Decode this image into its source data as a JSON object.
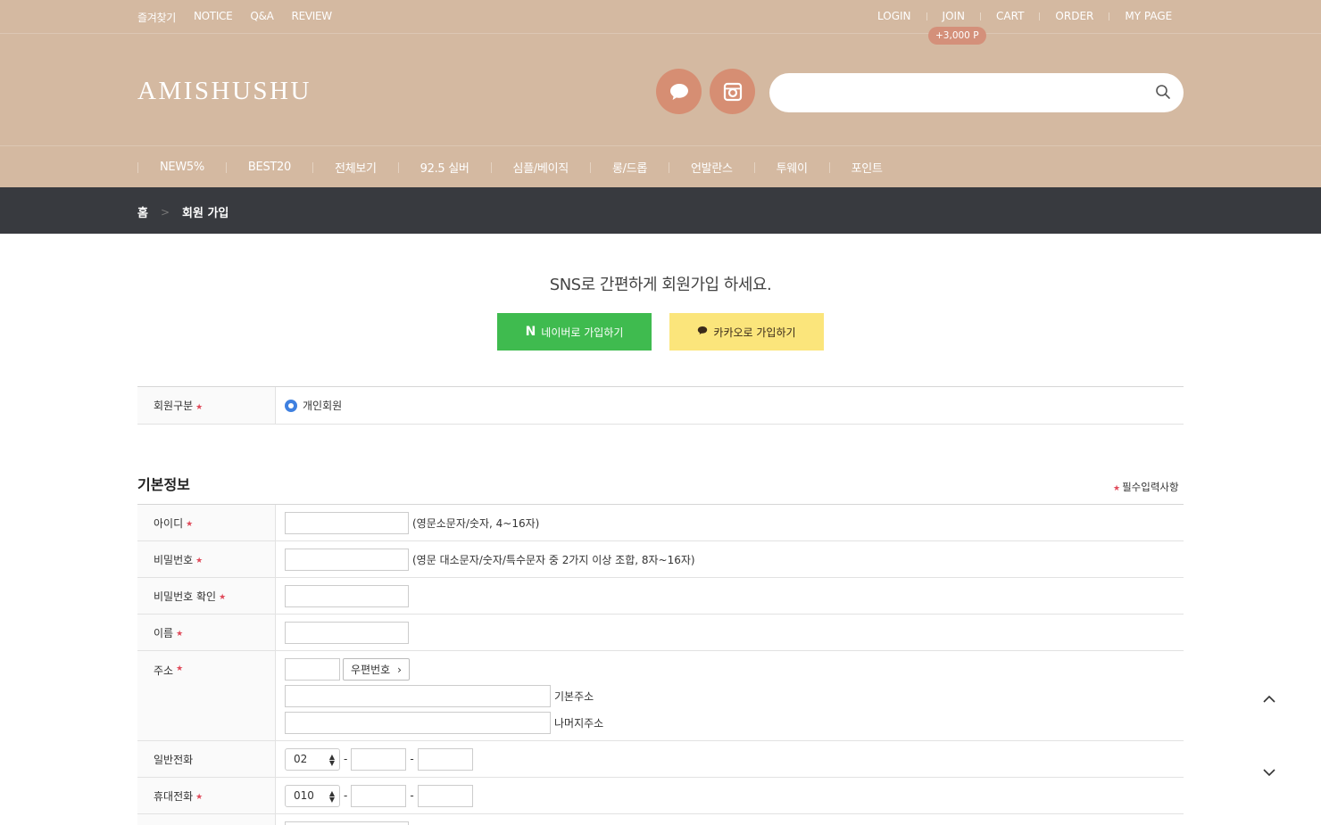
{
  "top_links_left": [
    "즐겨찾기",
    "NOTICE",
    "Q&A",
    "REVIEW"
  ],
  "top_links_right": [
    "LOGIN",
    "JOIN",
    "CART",
    "ORDER",
    "MY PAGE"
  ],
  "points_badge": "+3,000 P",
  "logo": "AMISHUSHU",
  "search": {
    "placeholder": ""
  },
  "icons": {
    "chat": "chat-bubble-icon",
    "instagram": "instagram-icon",
    "search": "search-icon"
  },
  "gnb": [
    "NEW5%",
    "BEST20",
    "전체보기",
    "92.5 실버",
    "심플/베이직",
    "롱/드롭",
    "언발란스",
    "투웨이",
    "포인트"
  ],
  "breadcrumb": {
    "home": "홈",
    "current": "회원 가입"
  },
  "sns": {
    "title": "SNS로 간편하게 회원가입 하세요.",
    "naver": "네이버로 가입하기",
    "kakao": "카카오로 가입하기"
  },
  "member_type": {
    "label": "회원구분",
    "option": "개인회원"
  },
  "basic_info": {
    "title": "기본정보",
    "required_note": "필수입력사항"
  },
  "fields": {
    "id": {
      "label": "아이디",
      "hint": "(영문소문자/숫자, 4~16자)"
    },
    "password": {
      "label": "비밀번호",
      "hint": "(영문 대소문자/숫자/특수문자 중 2가지 이상 조합, 8자~16자)"
    },
    "password_confirm": {
      "label": "비밀번호 확인"
    },
    "name": {
      "label": "이름"
    },
    "address": {
      "label": "주소",
      "zip_button": "우편번호",
      "basic": "기본주소",
      "detail": "나머지주소"
    },
    "phone": {
      "label": "일반전화",
      "area": "02",
      "dash": "-"
    },
    "mobile": {
      "label": "휴대전화",
      "prefix": "010",
      "dash": "-"
    }
  },
  "colors": {
    "header_bg": "#d4b9a1",
    "crumb_bg": "#383a3f",
    "naver": "#3fbb4f",
    "kakao": "#fbe57b",
    "accent": "#d68e73",
    "required": "#e04a5a"
  }
}
